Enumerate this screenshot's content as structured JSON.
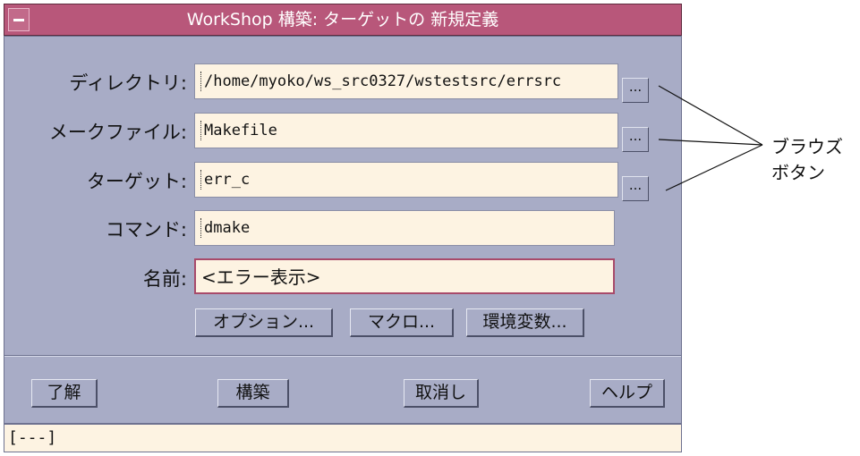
{
  "window": {
    "title": "WorkShop 構築: ターゲットの 新規定義"
  },
  "form": {
    "directory": {
      "label": "ディレクトリ:",
      "value": "/home/myoko/ws_src0327/wstestsrc/errsrc"
    },
    "makefile": {
      "label": "メークファイル:",
      "value": "Makefile"
    },
    "target": {
      "label": "ターゲット:",
      "value": "err_c"
    },
    "command": {
      "label": "コマンド:",
      "value": "dmake"
    },
    "name": {
      "label": "名前:",
      "value": "<エラー表示>"
    },
    "browse_label": "..."
  },
  "option_buttons": {
    "options": "オプション...",
    "macro": "マクロ...",
    "env": "環境変数..."
  },
  "action_buttons": {
    "ok": "了解",
    "build": "構築",
    "cancel": "取消し",
    "help": "ヘルプ"
  },
  "status": {
    "text": "[---]"
  },
  "annotation": {
    "line1": "ブラウズ",
    "line2": "ボタン"
  }
}
